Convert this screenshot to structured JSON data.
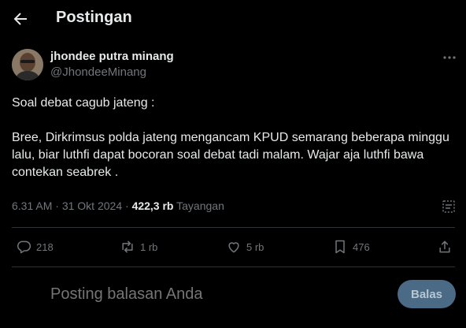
{
  "header": {
    "title": "Postingan"
  },
  "author": {
    "display_name": "jhondee putra minang",
    "handle": "@JhondeeMinang"
  },
  "tweet": {
    "line1": "Soal debat cagub jateng :",
    "line2": "Bree, Dirkrimsus polda jateng mengancam KPUD semarang beberapa minggu lalu, biar luthfi dapat bocoran soal debat tadi malam. Wajar aja luthfi bawa contekan seabrek ."
  },
  "meta": {
    "time": "6.31 AM",
    "separator": "·",
    "date": "31 Okt 2024",
    "views_count": "422,3 rb",
    "views_label": "Tayangan"
  },
  "actions": {
    "replies": "218",
    "reposts": "1 rb",
    "likes": "5 rb",
    "bookmarks": "476"
  },
  "reply": {
    "placeholder": "Posting balasan Anda",
    "button_label": "Balas"
  },
  "icons": [
    "back-arrow-icon",
    "more-icon",
    "analytics-icon",
    "reply-icon",
    "repost-icon",
    "like-icon",
    "bookmark-icon",
    "share-icon"
  ],
  "colors": {
    "background": "#000000",
    "text": "#e7e9ea",
    "muted": "#71767b",
    "divider": "#2f3336",
    "button": "#4a6a85"
  }
}
